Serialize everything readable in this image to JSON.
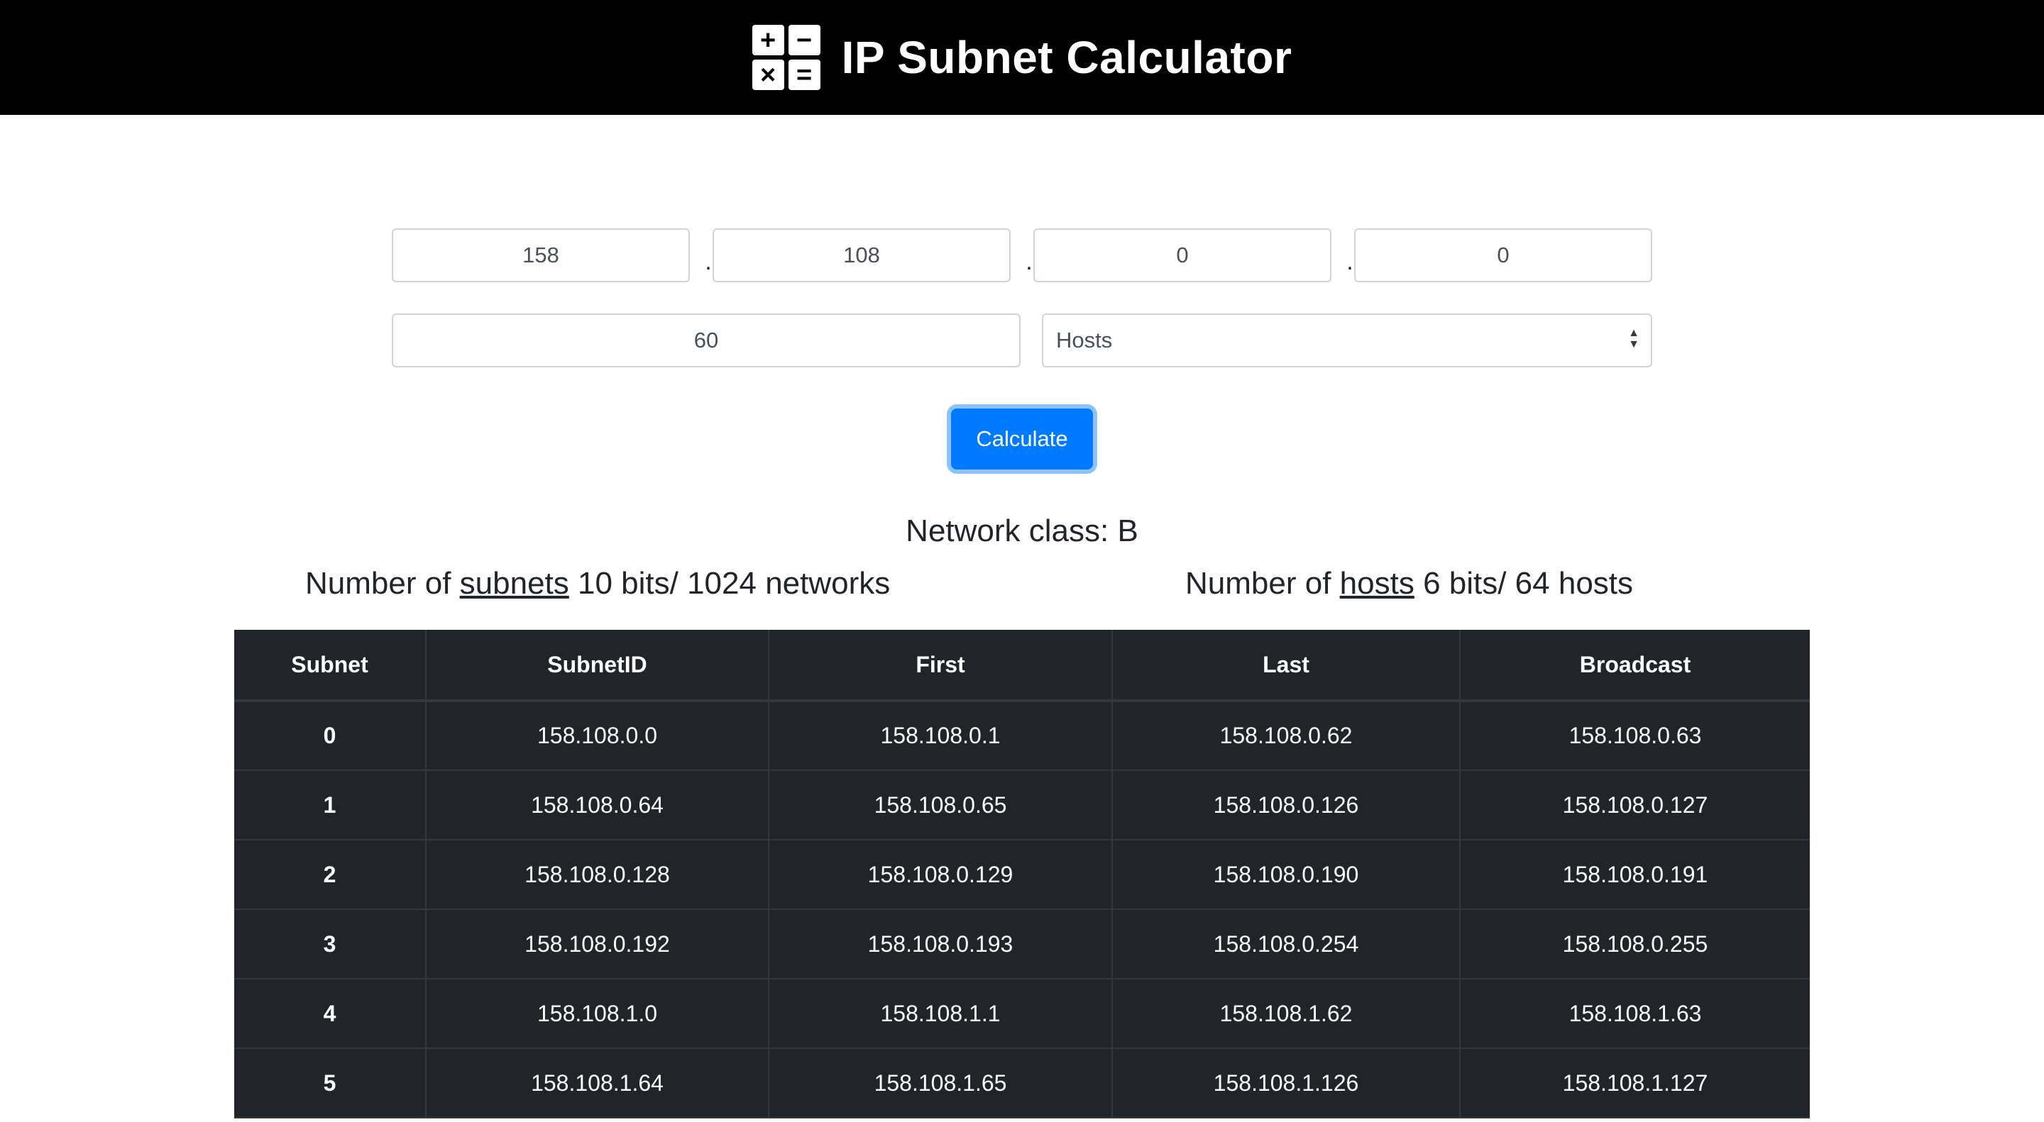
{
  "header": {
    "title": "IP Subnet Calculator",
    "icon_glyphs": [
      "+",
      "−",
      "×",
      "="
    ]
  },
  "form": {
    "octets": [
      "158",
      "108",
      "0",
      "0"
    ],
    "separator": ".",
    "count_value": "60",
    "mode_select": {
      "selected": "Hosts"
    },
    "calculate_label": "Calculate"
  },
  "results": {
    "network_class": "Network class: B",
    "subnets": {
      "prefix": "Number of",
      "link": "subnets",
      "suffix": "10 bits/ 1024 networks"
    },
    "hosts": {
      "prefix": "Number of",
      "link": "hosts",
      "suffix": "6 bits/ 64 hosts"
    }
  },
  "table": {
    "headers": [
      "Subnet",
      "SubnetID",
      "First",
      "Last",
      "Broadcast"
    ],
    "rows": [
      [
        "0",
        "158.108.0.0",
        "158.108.0.1",
        "158.108.0.62",
        "158.108.0.63"
      ],
      [
        "1",
        "158.108.0.64",
        "158.108.0.65",
        "158.108.0.126",
        "158.108.0.127"
      ],
      [
        "2",
        "158.108.0.128",
        "158.108.0.129",
        "158.108.0.190",
        "158.108.0.191"
      ],
      [
        "3",
        "158.108.0.192",
        "158.108.0.193",
        "158.108.0.254",
        "158.108.0.255"
      ],
      [
        "4",
        "158.108.1.0",
        "158.108.1.1",
        "158.108.1.62",
        "158.108.1.63"
      ],
      [
        "5",
        "158.108.1.64",
        "158.108.1.65",
        "158.108.1.126",
        "158.108.1.127"
      ]
    ]
  },
  "colors": {
    "header_bg": "#000000",
    "button_primary": "#007bff",
    "table_bg": "#212529"
  }
}
